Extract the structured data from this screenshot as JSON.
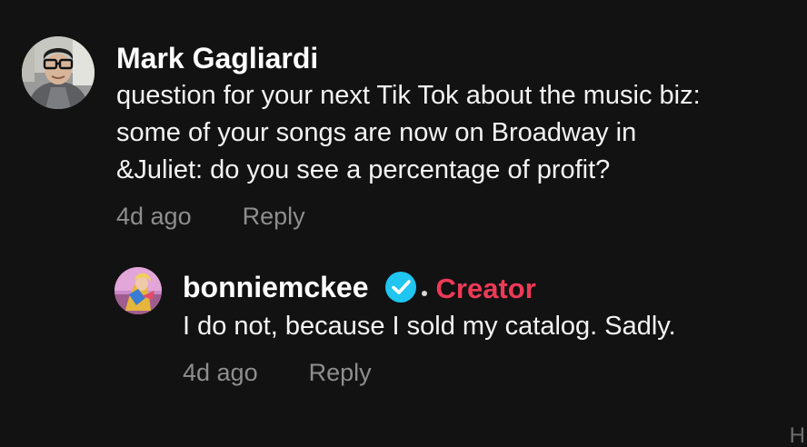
{
  "comments": [
    {
      "author": "Mark Gagliardi",
      "text": "question for your next Tik Tok about the music biz:\nsome of your songs are now on Broadway in\n&Juliet: do you see a percentage of profit?",
      "time": "4d ago",
      "reply_label": "Reply",
      "avatar_icon": "person-with-glasses-avatar"
    }
  ],
  "reply": {
    "author": "bonniemckee",
    "verified_icon": "verified-check-icon",
    "badge": "Creator",
    "text": "I do not, because I sold my catalog. Sadly.",
    "time": "4d ago",
    "reply_label": "Reply",
    "avatar_icon": "colorful-artist-avatar"
  },
  "corner_mark": "H",
  "colors": {
    "background": "#121212",
    "creator_badge": "#ee3a57",
    "verified": "#20c5f0",
    "meta": "#8e8e8e"
  }
}
